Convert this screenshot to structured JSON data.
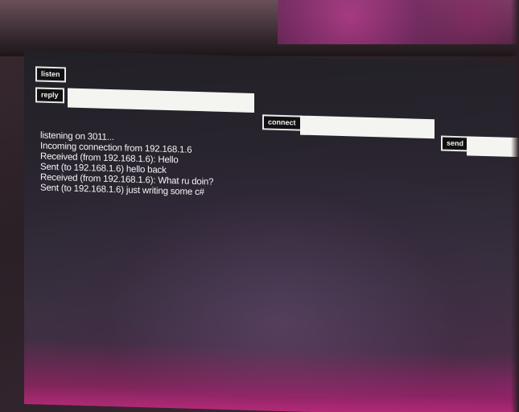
{
  "toolbar": {
    "listen_label": "listen",
    "reply_label": "reply",
    "reply_value": "",
    "connect_label": "connect",
    "connect_value": "",
    "send_label": "send",
    "send_value": ""
  },
  "log": [
    "listening on 3011...",
    "Incoming connection from 192.168.1.6",
    "Received (from 192.168.1.6): Hello",
    "Sent (to 192.168.1.6) hello back",
    "Received (from 192.168.1.6): What ru doin?",
    "Sent (to 192.168.1.6) just writing some c#"
  ],
  "colors": {
    "screen_bg": "#222026",
    "button_border": "#e8e8e8",
    "field_bg": "#f4f4f0",
    "text": "#f4f4f4"
  }
}
